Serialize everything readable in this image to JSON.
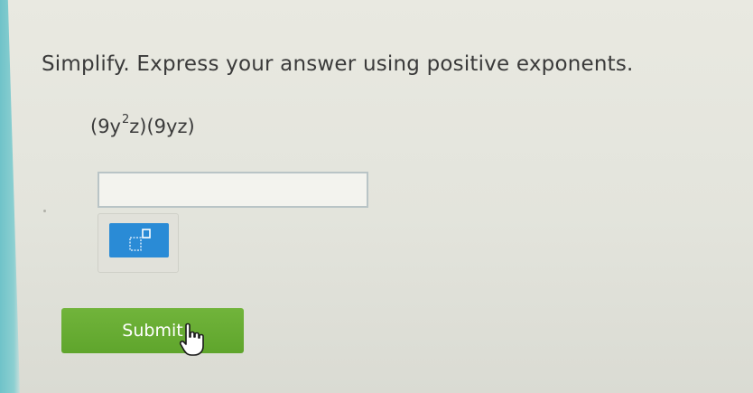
{
  "question": {
    "prompt": "Simplify. Express your answer using positive exponents.",
    "expression": {
      "part1": "(9y",
      "exponent": "2",
      "part2": "z)(9yz)"
    }
  },
  "answer": {
    "value": "",
    "placeholder": ""
  },
  "toolbar": {
    "tool_icon": "exponent-box-icon"
  },
  "submit": {
    "label": "Submit"
  },
  "colors": {
    "submit_green": "#5fa52c",
    "tool_blue": "#2a8bd6",
    "edge_teal": "#6fc3c9"
  },
  "cursor_icon": "hand-pointer-icon"
}
